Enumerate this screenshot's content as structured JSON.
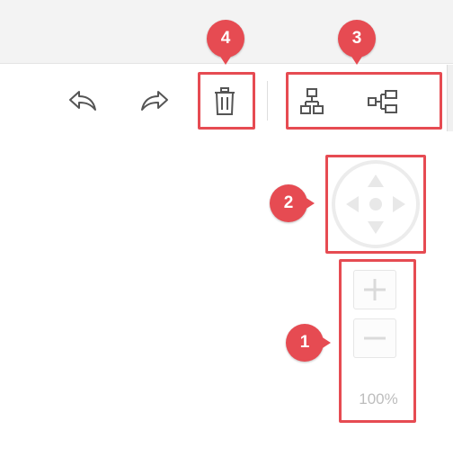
{
  "toolbar": {
    "undo_icon": "undo-icon",
    "redo_icon": "redo-icon",
    "delete_icon": "trash-icon",
    "layout_vertical_icon": "vertical-layout-icon",
    "layout_horizontal_icon": "horizontal-layout-icon"
  },
  "navigator": {
    "pan_icon": "pan-arrows-icon"
  },
  "zoom": {
    "in_icon": "plus-icon",
    "out_icon": "minus-icon",
    "level": "100%"
  },
  "annotations": {
    "marker_1": "1",
    "marker_2": "2",
    "marker_3": "3",
    "marker_4": "4",
    "color": "#e64b52"
  }
}
